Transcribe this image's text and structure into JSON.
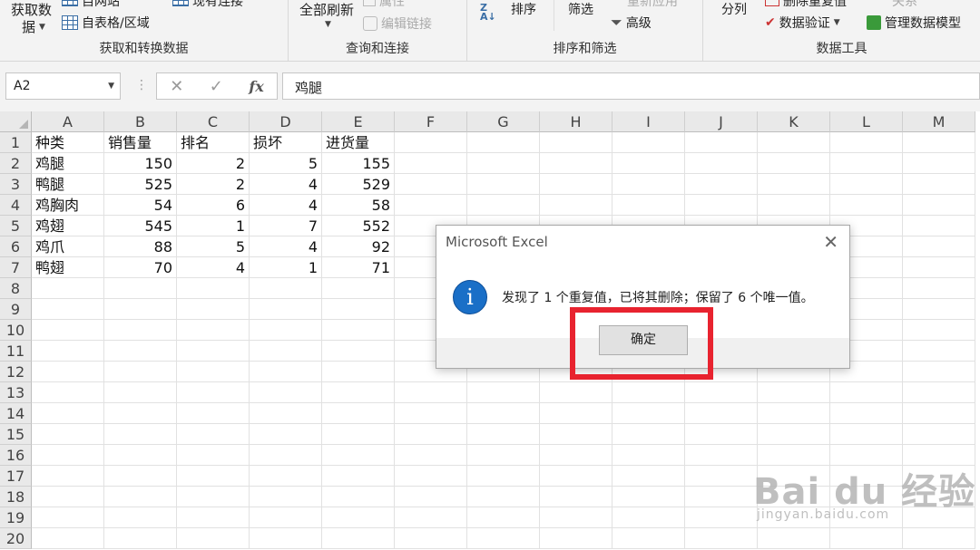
{
  "ribbon": {
    "groups": {
      "get_transform": {
        "label": "获取和转换数据",
        "get_data_line1": "获取数",
        "get_data_line2": "据",
        "from_web": "自网站",
        "from_table": "自表格/区域",
        "recent_sources": "现有连接"
      },
      "queries": {
        "label": "查询和连接",
        "refresh_all": "全部刷新",
        "properties": "属性",
        "edit_links": "编辑链接"
      },
      "sort_filter": {
        "label": "排序和筛选",
        "sort": "排序",
        "filter": "筛选",
        "reapply": "重新应用",
        "advanced": "高级"
      },
      "data_tools": {
        "label": "数据工具",
        "text_to_columns": "分列",
        "remove_duplicates": "删除重复值",
        "data_validation": "数据验证",
        "consolidate": "关系",
        "manage_model": "管理数据模型"
      }
    }
  },
  "formula_bar": {
    "name_box": "A2",
    "cancel_glyph": "✕",
    "enter_glyph": "✓",
    "fx_glyph": "fx",
    "content": "鸡腿"
  },
  "sheet": {
    "columns": [
      "A",
      "B",
      "C",
      "D",
      "E",
      "F",
      "G",
      "H",
      "I",
      "J",
      "K",
      "L",
      "M"
    ],
    "rows": [
      "1",
      "2",
      "3",
      "4",
      "5",
      "6",
      "7",
      "8",
      "9",
      "10",
      "11",
      "12",
      "13",
      "14",
      "15",
      "16",
      "17",
      "18",
      "19",
      "20"
    ],
    "header_row": [
      "种类",
      "销售量",
      "排名",
      "损坏",
      "进货量"
    ],
    "data": [
      [
        "鸡腿",
        "150",
        "2",
        "5",
        "155"
      ],
      [
        "鸭腿",
        "525",
        "2",
        "4",
        "529"
      ],
      [
        "鸡胸肉",
        "54",
        "6",
        "4",
        "58"
      ],
      [
        "鸡翅",
        "545",
        "1",
        "7",
        "552"
      ],
      [
        "鸡爪",
        "88",
        "5",
        "4",
        "92"
      ],
      [
        "鸭翅",
        "70",
        "4",
        "1",
        "71"
      ]
    ]
  },
  "dialog": {
    "title": "Microsoft Excel",
    "close_glyph": "✕",
    "icon_glyph": "i",
    "message": "发现了 1 个重复值，已将其删除；保留了 6 个唯一值。",
    "ok_label": "确定",
    "highlight_color": "#e8232f"
  },
  "watermark": {
    "brand": "Bai du 经验",
    "url": "jingyan.baidu.com"
  }
}
